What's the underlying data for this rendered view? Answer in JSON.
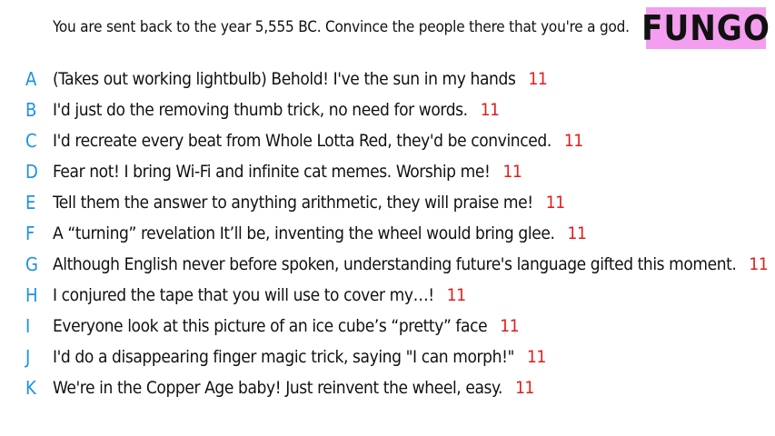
{
  "prompt": "You are sent back to the year 5,555 BC. Convince the people there that you're a god.",
  "badge": "FUNGO",
  "colors": {
    "letter": "#1e90e6",
    "score": "#e21b1b",
    "badge_bg": "#f49ef0"
  },
  "answers": [
    {
      "letter": "A",
      "text": "(Takes out working lightbulb) Behold! I've the sun in my hands",
      "score": "11"
    },
    {
      "letter": "B",
      "text": "I'd just do the removing thumb trick, no need for words.",
      "score": "11"
    },
    {
      "letter": "C",
      "text": "I'd recreate every beat from Whole Lotta Red, they'd be convinced.",
      "score": "11"
    },
    {
      "letter": "D",
      "text": "Fear not! I bring Wi-Fi and infinite cat memes. Worship me!",
      "score": "11"
    },
    {
      "letter": "E",
      "text": "Tell them the answer to anything arithmetic, they will praise me!",
      "score": "11"
    },
    {
      "letter": "F",
      "text": "A “turning” revelation It’ll be, inventing the wheel would bring glee.",
      "score": "11"
    },
    {
      "letter": "G",
      "text": "Although English never before spoken, understanding future's language gifted this moment.",
      "score": "11"
    },
    {
      "letter": "H",
      "text": "I conjured the tape that you will use to cover my…!",
      "score": "11"
    },
    {
      "letter": "I",
      "text": "Everyone look at this picture of an ice cube’s “pretty” face",
      "score": "11"
    },
    {
      "letter": "J",
      "text": "I'd do a disappearing finger magic trick, saying \"I can morph!\"",
      "score": "11"
    },
    {
      "letter": "K",
      "text": "We're in the Copper Age baby! Just reinvent the wheel, easy.",
      "score": "11"
    }
  ]
}
